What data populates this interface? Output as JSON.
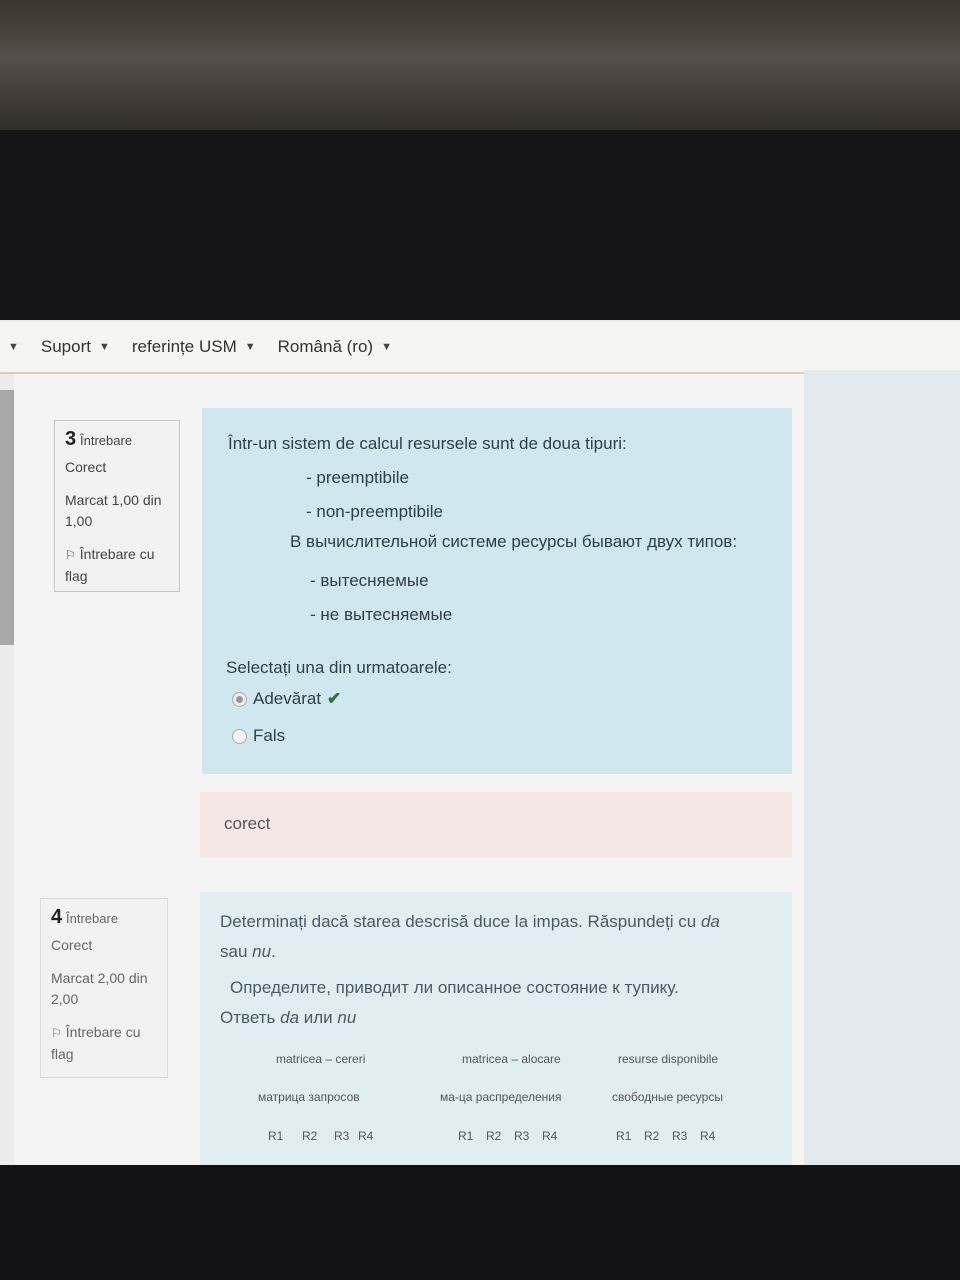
{
  "navbar": {
    "items": [
      "Suport",
      "referințe USM",
      "Română (ro)"
    ]
  },
  "question3": {
    "info": {
      "number": "3",
      "label": "Întrebare",
      "state": "Corect",
      "grade": "Marcat 1,00 din 1,00",
      "flag": "Întrebare cu flag"
    },
    "lines": [
      "Într-un sistem de calcul resursele sunt de doua tipuri:",
      "- preemptibile",
      "- non-preemptibile",
      "В вычислительной системе ресурсы бывают двух типов:",
      "- вытесняемые",
      "- не вытесняемые"
    ],
    "prompt": "Selectați una din urmatoarele:",
    "options": [
      "Adevărat",
      "Fals"
    ],
    "feedback": "corect"
  },
  "question4": {
    "info": {
      "number": "4",
      "label": "Întrebare",
      "state": "Corect",
      "grade": "Marcat 2,00 din 2,00",
      "flag": "Întrebare cu flag"
    },
    "text_ro_1": "Determinați dacă starea descrisă duce la impas. Răspundeți cu ",
    "text_ro_da": "da",
    "text_ro_2": "sau ",
    "text_ro_nu": "nu",
    "text_ro_end": ".",
    "text_ru_1": "Определите, приводит ли описанное состояние к тупику.",
    "text_ru_2": "Ответь ",
    "text_ru_da": "da",
    "text_ru_mid": " или ",
    "text_ru_nu": "nu",
    "table": {
      "headers_ro": [
        "matricea – cereri",
        "matricea – alocare",
        "resurse disponibile"
      ],
      "headers_ru": [
        "матрица запросов",
        "ма-ца распределения",
        "свободные ресурсы"
      ],
      "cols": [
        "R1",
        "R2",
        "R3",
        "R4"
      ]
    }
  }
}
